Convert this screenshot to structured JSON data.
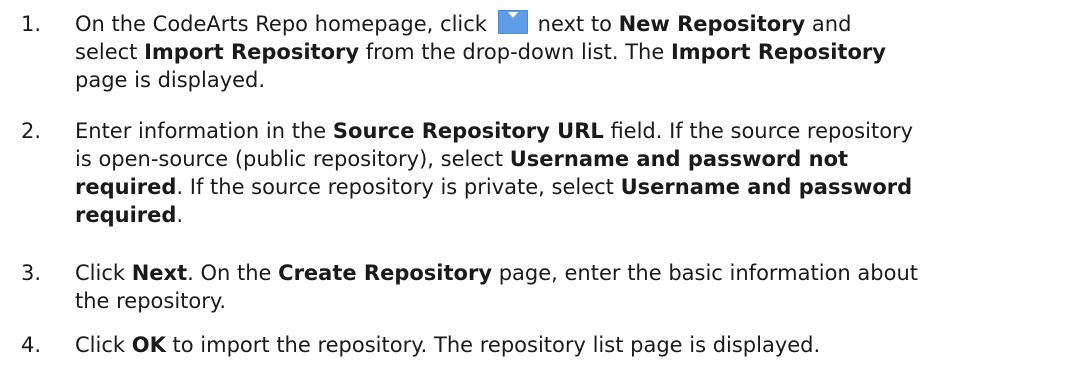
{
  "steps": [
    {
      "number": "1.",
      "segments": [
        "On the CodeArts Repo homepage, click",
        "next to",
        "New Repository",
        "and",
        "select",
        "Import Repository",
        "from the drop-down list. The",
        "Import Repository",
        "page is displayed."
      ],
      "icon": "dropdown-arrow-icon",
      "icon_color": "#5e9de8"
    },
    {
      "number": "2.",
      "segments": [
        "Enter information in the",
        "Source Repository URL",
        "field. If the source repository",
        "is open-source (public repository), select",
        "Username and password not",
        "required",
        ". If the source repository is private, select",
        "Username and password",
        "required",
        "."
      ]
    },
    {
      "number": "3.",
      "segments": [
        "Click",
        "Next",
        ". On the",
        "Create Repository",
        "page, enter the basic information about",
        "the repository."
      ]
    },
    {
      "number": "4.",
      "segments": [
        "Click",
        "OK",
        "to import the repository. The repository list page is displayed."
      ]
    }
  ]
}
